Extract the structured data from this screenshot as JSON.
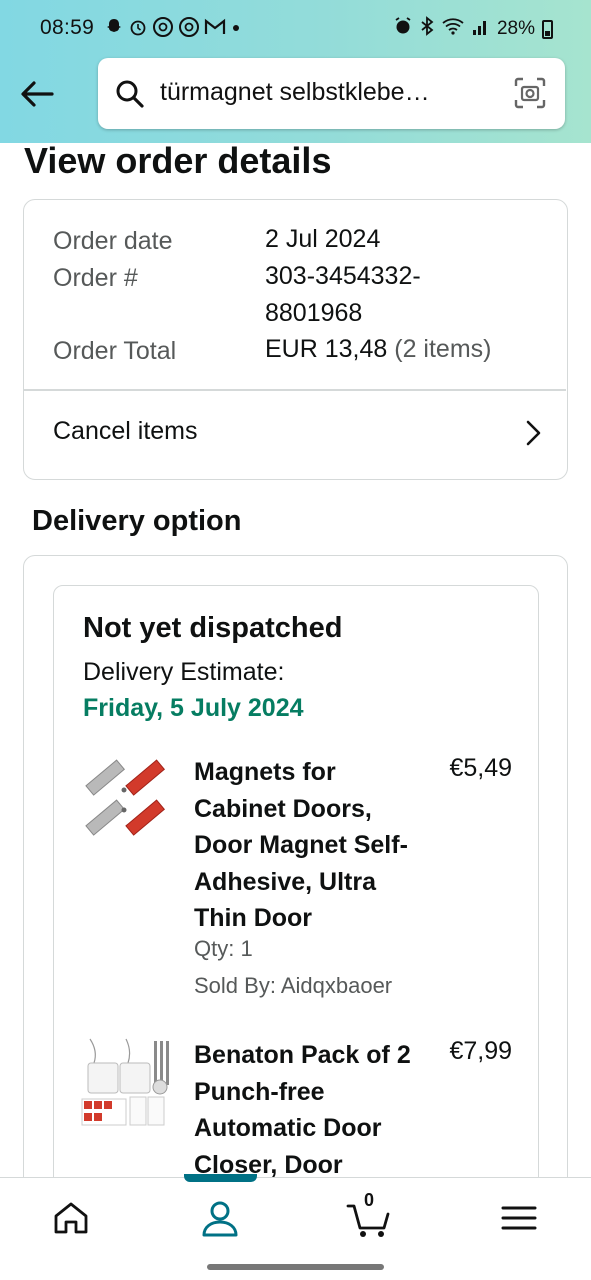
{
  "status_bar": {
    "time": "08:59",
    "battery": "28%",
    "left_icons": [
      "snapchat-icon",
      "alarm-icon",
      "threads-icon",
      "threads-icon",
      "gmail-icon",
      "dot-icon"
    ],
    "right_icons": [
      "alarm-icon",
      "bluetooth-icon",
      "wifi-icon",
      "signal-icon",
      "battery-icon"
    ]
  },
  "search": {
    "query": "türmagnet selbstklebe…"
  },
  "page": {
    "title": "View order details"
  },
  "order": {
    "date_label": "Order date",
    "date_value": "2 Jul 2024",
    "number_label": "Order #",
    "number_value_line1": "303-3454332-",
    "number_value_line2": "8801968",
    "total_label": "Order Total",
    "total_value": "EUR 13,48",
    "total_items": "(2 items)",
    "cancel_label": "Cancel items"
  },
  "delivery": {
    "section_title": "Delivery option",
    "status": "Not yet dispatched",
    "estimate_label": "Delivery Estimate:",
    "estimate_date": "Friday, 5 July 2024",
    "items": [
      {
        "name": "Magnets for Cabinet Doors, Door Magnet Self-Adhesive, Ultra Thin Door",
        "price": "€5,49",
        "qty": "Qty: 1",
        "seller": "Sold By: Aidqxbaoer"
      },
      {
        "name": "Benaton Pack of 2 Punch-free Automatic Door Closer, Door",
        "price": "€7,99"
      }
    ]
  },
  "bottom_nav": {
    "items": [
      "home-icon",
      "account-icon",
      "cart-icon",
      "menu-icon"
    ],
    "cart_count": "0",
    "active": "account-icon"
  },
  "colors": {
    "accent": "#007185",
    "delivery_green": "#067d62",
    "header_gradient_start": "#82d8e3",
    "header_gradient_end": "#a6e4cf"
  }
}
